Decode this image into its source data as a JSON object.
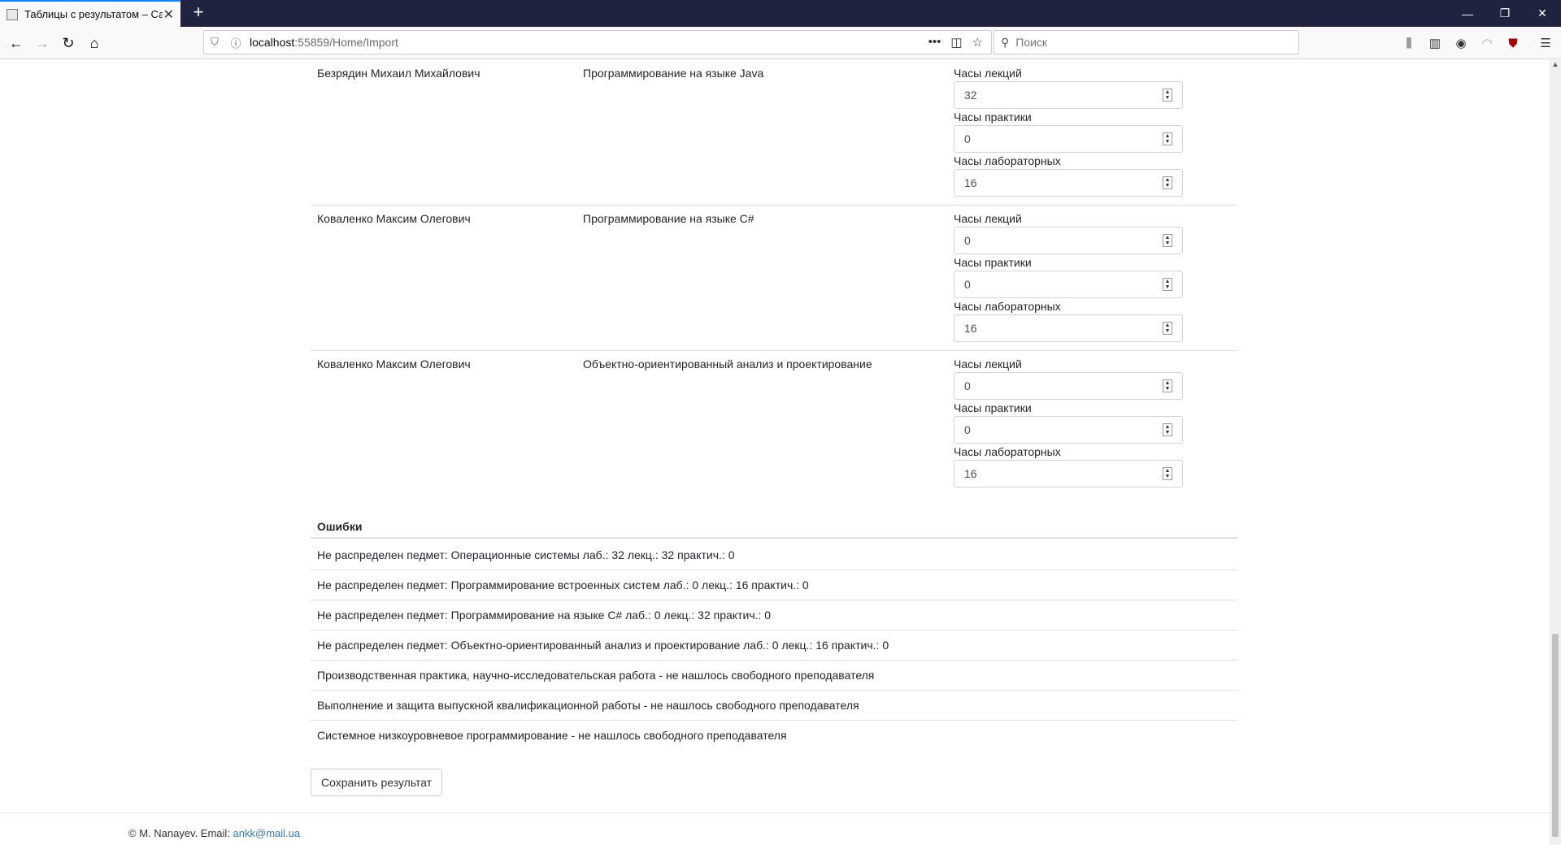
{
  "browser": {
    "tab_title": "Таблицы с результатом – Сай",
    "url_host": "localhost",
    "url_rest": ":55859/Home/Import",
    "search_placeholder": "Поиск"
  },
  "rows": [
    {
      "name": "Безрядин Михаил Михайлович",
      "subject": "Программирование на языке Java",
      "lectures_label": "Часы лекций",
      "lectures": "32",
      "practice_label": "Часы практики",
      "practice": "0",
      "labs_label": "Часы лабораторных",
      "labs": "16"
    },
    {
      "name": "Коваленко Максим Олегович",
      "subject": "Программирование на языке C#",
      "lectures_label": "Часы лекций",
      "lectures": "0",
      "practice_label": "Часы практики",
      "practice": "0",
      "labs_label": "Часы лабораторных",
      "labs": "16"
    },
    {
      "name": "Коваленко Максим Олегович",
      "subject": "Объектно-ориентированный анализ и проектирование",
      "lectures_label": "Часы лекций",
      "lectures": "0",
      "practice_label": "Часы практики",
      "practice": "0",
      "labs_label": "Часы лабораторных",
      "labs": "16"
    }
  ],
  "errors": {
    "heading": "Ошибки",
    "items": [
      "Не распределен педмет: Операционные системы лаб.: 32 лекц.: 32 практич.: 0",
      "Не распределен педмет: Программирование встроенных систем лаб.: 0 лекц.: 16 практич.: 0",
      "Не распределен педмет: Программирование на языке C# лаб.: 0 лекц.: 32 практич.: 0",
      "Не распределен педмет: Объектно-ориентированный анализ и проектирование лаб.: 0 лекц.: 16 практич.: 0",
      "Производственная практика, научно-исследовательская работа - не нашлось свободного преподавателя",
      "Выполнение и защита выпускной квалификационной работы - не нашлось свободного преподавателя",
      "Системное низкоуровневое программирование - не нашлось свободного преподавателя"
    ]
  },
  "save_label": "Сохранить результат",
  "footer": {
    "text": "© M. Nanayev. Email: ",
    "email": "ankk@mail.ua"
  }
}
